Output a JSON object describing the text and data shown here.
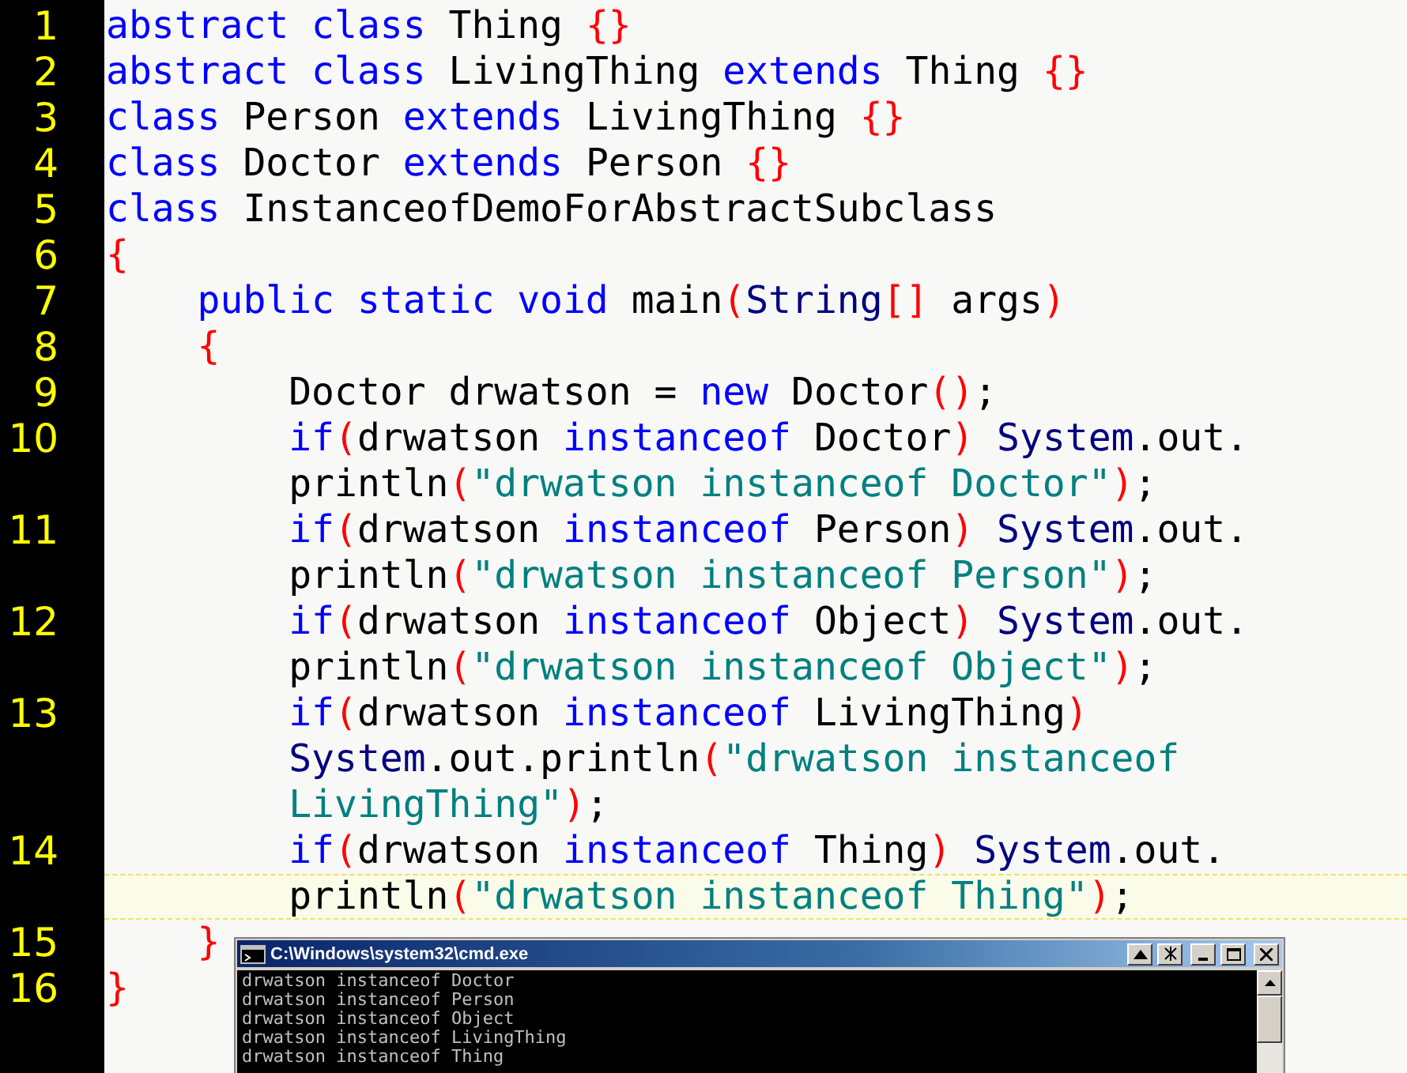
{
  "editor": {
    "lines": [
      {
        "number": "1",
        "current": false,
        "rows": [
          {
            "tokens": [
              {
                "kind": "keyword",
                "text": "abstract class"
              },
              {
                "kind": "plain",
                "text": " Thing "
              },
              {
                "kind": "brace",
                "text": "{}"
              }
            ]
          }
        ]
      },
      {
        "number": "2",
        "current": false,
        "rows": [
          {
            "tokens": [
              {
                "kind": "keyword",
                "text": "abstract class"
              },
              {
                "kind": "plain",
                "text": " LivingThing "
              },
              {
                "kind": "keyword",
                "text": "extends"
              },
              {
                "kind": "plain",
                "text": " Thing "
              },
              {
                "kind": "brace",
                "text": "{}"
              }
            ]
          }
        ]
      },
      {
        "number": "3",
        "current": false,
        "rows": [
          {
            "tokens": [
              {
                "kind": "keyword",
                "text": "class"
              },
              {
                "kind": "plain",
                "text": " Person "
              },
              {
                "kind": "keyword",
                "text": "extends"
              },
              {
                "kind": "plain",
                "text": " LivingThing "
              },
              {
                "kind": "brace",
                "text": "{}"
              }
            ]
          }
        ]
      },
      {
        "number": "4",
        "current": false,
        "rows": [
          {
            "tokens": [
              {
                "kind": "keyword",
                "text": "class"
              },
              {
                "kind": "plain",
                "text": " Doctor "
              },
              {
                "kind": "keyword",
                "text": "extends"
              },
              {
                "kind": "plain",
                "text": " Person "
              },
              {
                "kind": "brace",
                "text": "{}"
              }
            ]
          }
        ]
      },
      {
        "number": "5",
        "current": false,
        "rows": [
          {
            "tokens": [
              {
                "kind": "keyword",
                "text": "class"
              },
              {
                "kind": "plain",
                "text": " InstanceofDemoForAbstractSubclass"
              }
            ]
          }
        ]
      },
      {
        "number": "6",
        "current": false,
        "rows": [
          {
            "tokens": [
              {
                "kind": "brace",
                "text": "{"
              }
            ]
          }
        ]
      },
      {
        "number": "7",
        "current": false,
        "rows": [
          {
            "tokens": [
              {
                "kind": "keyword",
                "text": "    public static void"
              },
              {
                "kind": "plain",
                "text": " main"
              },
              {
                "kind": "brace",
                "text": "("
              },
              {
                "kind": "type",
                "text": "String"
              },
              {
                "kind": "brace",
                "text": "[]"
              },
              {
                "kind": "plain",
                "text": " args"
              },
              {
                "kind": "brace",
                "text": ")"
              }
            ]
          }
        ]
      },
      {
        "number": "8",
        "current": false,
        "rows": [
          {
            "tokens": [
              {
                "kind": "brace",
                "text": "    {"
              }
            ]
          }
        ]
      },
      {
        "number": "9",
        "current": false,
        "rows": [
          {
            "tokens": [
              {
                "kind": "plain",
                "text": "        Doctor drwatson = "
              },
              {
                "kind": "keyword",
                "text": "new"
              },
              {
                "kind": "plain",
                "text": " Doctor"
              },
              {
                "kind": "brace",
                "text": "()"
              },
              {
                "kind": "plain",
                "text": ";"
              }
            ]
          }
        ]
      },
      {
        "number": "10",
        "current": false,
        "rows": [
          {
            "tokens": [
              {
                "kind": "keyword",
                "text": "        if"
              },
              {
                "kind": "brace",
                "text": "("
              },
              {
                "kind": "plain",
                "text": "drwatson "
              },
              {
                "kind": "keyword",
                "text": "instanceof"
              },
              {
                "kind": "plain",
                "text": " Doctor"
              },
              {
                "kind": "brace",
                "text": ")"
              },
              {
                "kind": "type",
                "text": " System"
              },
              {
                "kind": "plain",
                "text": ".out."
              }
            ]
          },
          {
            "tokens": [
              {
                "kind": "plain",
                "text": "        println"
              },
              {
                "kind": "brace",
                "text": "("
              },
              {
                "kind": "string",
                "text": "\"drwatson instanceof Doctor\""
              },
              {
                "kind": "brace",
                "text": ")"
              },
              {
                "kind": "plain",
                "text": ";"
              }
            ]
          }
        ]
      },
      {
        "number": "11",
        "current": false,
        "rows": [
          {
            "tokens": [
              {
                "kind": "keyword",
                "text": "        if"
              },
              {
                "kind": "brace",
                "text": "("
              },
              {
                "kind": "plain",
                "text": "drwatson "
              },
              {
                "kind": "keyword",
                "text": "instanceof"
              },
              {
                "kind": "plain",
                "text": " Person"
              },
              {
                "kind": "brace",
                "text": ")"
              },
              {
                "kind": "type",
                "text": " System"
              },
              {
                "kind": "plain",
                "text": ".out."
              }
            ]
          },
          {
            "tokens": [
              {
                "kind": "plain",
                "text": "        println"
              },
              {
                "kind": "brace",
                "text": "("
              },
              {
                "kind": "string",
                "text": "\"drwatson instanceof Person\""
              },
              {
                "kind": "brace",
                "text": ")"
              },
              {
                "kind": "plain",
                "text": ";"
              }
            ]
          }
        ]
      },
      {
        "number": "12",
        "current": false,
        "rows": [
          {
            "tokens": [
              {
                "kind": "keyword",
                "text": "        if"
              },
              {
                "kind": "brace",
                "text": "("
              },
              {
                "kind": "plain",
                "text": "drwatson "
              },
              {
                "kind": "keyword",
                "text": "instanceof"
              },
              {
                "kind": "plain",
                "text": " Object"
              },
              {
                "kind": "brace",
                "text": ")"
              },
              {
                "kind": "type",
                "text": " System"
              },
              {
                "kind": "plain",
                "text": ".out."
              }
            ]
          },
          {
            "tokens": [
              {
                "kind": "plain",
                "text": "        println"
              },
              {
                "kind": "brace",
                "text": "("
              },
              {
                "kind": "string",
                "text": "\"drwatson instanceof Object\""
              },
              {
                "kind": "brace",
                "text": ")"
              },
              {
                "kind": "plain",
                "text": ";"
              }
            ]
          }
        ]
      },
      {
        "number": "13",
        "current": false,
        "rows": [
          {
            "tokens": [
              {
                "kind": "keyword",
                "text": "        if"
              },
              {
                "kind": "brace",
                "text": "("
              },
              {
                "kind": "plain",
                "text": "drwatson "
              },
              {
                "kind": "keyword",
                "text": "instanceof"
              },
              {
                "kind": "plain",
                "text": " LivingThing"
              },
              {
                "kind": "brace",
                "text": ")"
              }
            ]
          },
          {
            "tokens": [
              {
                "kind": "type",
                "text": "        System"
              },
              {
                "kind": "plain",
                "text": ".out.println"
              },
              {
                "kind": "brace",
                "text": "("
              },
              {
                "kind": "string",
                "text": "\"drwatson instanceof"
              }
            ]
          },
          {
            "tokens": [
              {
                "kind": "string",
                "text": "        LivingThing\""
              },
              {
                "kind": "brace",
                "text": ")"
              },
              {
                "kind": "plain",
                "text": ";"
              }
            ]
          }
        ]
      },
      {
        "number": "14",
        "current": true,
        "rows": [
          {
            "tokens": [
              {
                "kind": "keyword",
                "text": "        if"
              },
              {
                "kind": "brace",
                "text": "("
              },
              {
                "kind": "plain",
                "text": "drwatson "
              },
              {
                "kind": "keyword",
                "text": "instanceof"
              },
              {
                "kind": "plain",
                "text": " Thing"
              },
              {
                "kind": "brace",
                "text": ")"
              },
              {
                "kind": "type",
                "text": " System"
              },
              {
                "kind": "plain",
                "text": ".out."
              }
            ]
          },
          {
            "tokens": [
              {
                "kind": "plain",
                "text": "        println"
              },
              {
                "kind": "brace",
                "text": "("
              },
              {
                "kind": "string",
                "text": "\"drwatson instanceof Thing\""
              },
              {
                "kind": "brace",
                "text": ")"
              },
              {
                "kind": "plain",
                "text": ";"
              }
            ]
          }
        ]
      },
      {
        "number": "15",
        "current": false,
        "rows": [
          {
            "tokens": [
              {
                "kind": "brace",
                "text": "    }"
              }
            ]
          }
        ]
      },
      {
        "number": "16",
        "current": false,
        "rows": [
          {
            "tokens": [
              {
                "kind": "brace",
                "text": "}"
              }
            ]
          }
        ]
      }
    ]
  },
  "console": {
    "title": "C:\\Windows\\system32\\cmd.exe",
    "output": [
      "drwatson instanceof Doctor",
      "drwatson instanceof Person",
      "drwatson instanceof Object",
      "drwatson instanceof LivingThing",
      "drwatson instanceof Thing"
    ]
  }
}
